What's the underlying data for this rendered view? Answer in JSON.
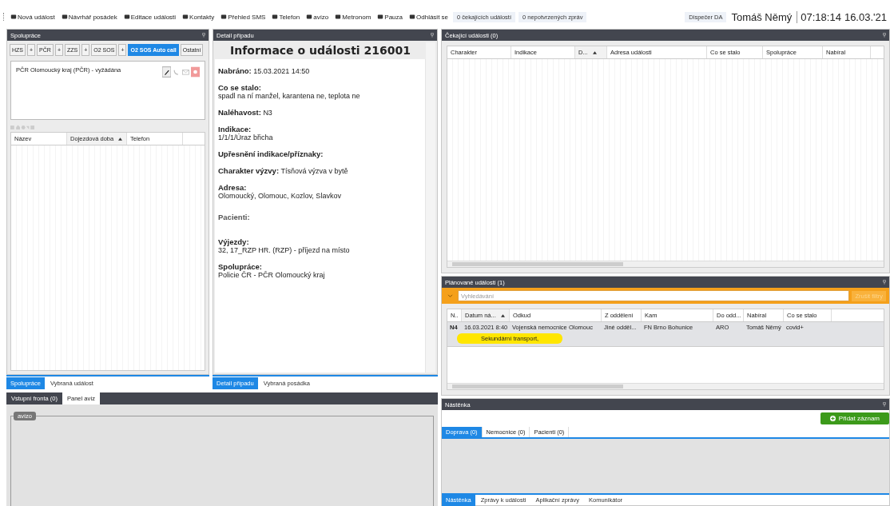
{
  "toolbar": {
    "items": [
      {
        "label": "Nová událost"
      },
      {
        "label": "Návrhář posádek"
      },
      {
        "label": "Editace události"
      },
      {
        "label": "Kontakty"
      },
      {
        "label": "Přehled SMS"
      },
      {
        "label": "Telefon"
      },
      {
        "label": "avízo"
      },
      {
        "label": "Metronom"
      },
      {
        "label": "Pauza"
      },
      {
        "label": "Odhlásit se"
      }
    ],
    "counters": [
      "0 čekajících událostí",
      "0 nepotvrzených zpráv"
    ],
    "role": "Dispečer DA",
    "user": "Tomáš Němý",
    "time": "07:18:14",
    "date": "16.03.'21"
  },
  "cooperation": {
    "title": "Spolupráce",
    "buttons": [
      {
        "label": "HZS",
        "selected": false
      },
      {
        "label": "+",
        "selected": false
      },
      {
        "label": "PČR",
        "selected": false
      },
      {
        "label": "+",
        "selected": false
      },
      {
        "label": "ZZS",
        "selected": false
      },
      {
        "label": "+",
        "selected": false
      },
      {
        "label": "O2 SOS",
        "selected": false
      },
      {
        "label": "+",
        "selected": false
      },
      {
        "label": "O2 SOS Auto call",
        "selected": true
      },
      {
        "label": "Ostatní",
        "selected": false
      }
    ],
    "items": [
      {
        "text": "PČR Olomoucký kraj (PČR) - vyžádána"
      }
    ],
    "columns": [
      {
        "label": "Název",
        "sorted": false
      },
      {
        "label": "Dojezdová doba",
        "sorted": true
      },
      {
        "label": "Telefon",
        "sorted": false
      }
    ],
    "tabs": [
      {
        "label": "Spolupráce",
        "selected": true
      },
      {
        "label": "Vybraná událost",
        "selected": false
      }
    ]
  },
  "detail": {
    "title": "Detail případu",
    "heading": "Informace o události 216001",
    "fields": [
      {
        "kind": "inline",
        "label": "Nabráno:",
        "value": "15.03.2021 14:50"
      },
      {
        "kind": "block",
        "label": "Co se stalo:",
        "value": "spadl na ní manžel, karantena ne, teplota ne"
      },
      {
        "kind": "inline",
        "label": "Naléhavost:",
        "value": "N3"
      },
      {
        "kind": "block",
        "label": "Indikace:",
        "value": "1/1/1/Úraz břicha"
      },
      {
        "kind": "block",
        "label": "Upřesnění indikace/příznaky:"
      },
      {
        "kind": "inline",
        "label": "Charakter výzvy:",
        "value": "Tísňová výzva v bytě"
      },
      {
        "kind": "block",
        "label": "Adresa:",
        "value": "Olomoucký, Olomouc, Kozlov, Slavkov"
      },
      {
        "kind": "empty",
        "label": "Pacienti:"
      },
      {
        "kind": "block",
        "label": "Výjezdy:",
        "value": "32, 17_RZP HR. (RZP) - příjezd na místo"
      },
      {
        "kind": "block",
        "label": "Spolupráce:",
        "value": "Policie ČR - PČR Olomoucký kraj"
      }
    ],
    "tabs": [
      {
        "label": "Detail případu",
        "selected": true
      },
      {
        "label": "Vybraná posádka",
        "selected": false
      }
    ]
  },
  "waiting": {
    "title": "Čekající události (0)",
    "columns": [
      {
        "label": "Charakter",
        "sorted": false
      },
      {
        "label": "Indikace",
        "sorted": false
      },
      {
        "label": "D...",
        "sorted": true
      },
      {
        "label": "Adresa události",
        "sorted": false
      },
      {
        "label": "Co se stalo",
        "sorted": false
      },
      {
        "label": "Spolupráce",
        "sorted": false
      },
      {
        "label": "Nabíral",
        "sorted": false
      }
    ]
  },
  "planned": {
    "title": "Plánované události (1)",
    "search": {
      "placeholder": "Vyhledávání"
    },
    "clear_button": {
      "label": "Zrušit filtry",
      "disabled": true
    },
    "columns": [
      {
        "label": "N..",
        "sorted": false
      },
      {
        "label": "Datum ná...",
        "sorted": true
      },
      {
        "label": "Odkud",
        "sorted": false
      },
      {
        "label": "Z oddělení",
        "sorted": false
      },
      {
        "label": "Kam",
        "sorted": false
      },
      {
        "label": "Do odd...",
        "sorted": false
      },
      {
        "label": "Nabíral",
        "sorted": false
      },
      {
        "label": "Co se stalo",
        "sorted": false
      }
    ],
    "rows": [
      {
        "selected": true,
        "cells": [
          "N4",
          "16.03.2021 8:40",
          "Vojenská nemocnice Olomouc",
          "Jiné odděl...",
          "FN Brno Bohunice",
          "ARO",
          "Tomáš Němý",
          "covid+"
        ],
        "tag": "Sekundární transport,"
      }
    ]
  },
  "board": {
    "title": "Nástěnka",
    "add_button": "Přidat záznam",
    "tabs": [
      {
        "label": "Doprava (0)",
        "selected": true
      },
      {
        "label": "Nemocnice (0)",
        "selected": false
      },
      {
        "label": "Pacienti (0)",
        "selected": false
      }
    ],
    "bottom_tabs": [
      {
        "label": "Nástěnka",
        "selected": true
      },
      {
        "label": "Zprávy k události",
        "selected": false
      },
      {
        "label": "Aplikační zprávy",
        "selected": false
      },
      {
        "label": "Komunikátor",
        "selected": false
      }
    ]
  },
  "notices": {
    "tabs": [
      {
        "label": "Vstupní fronta (0)",
        "selected": false
      },
      {
        "label": "Panel avíz",
        "selected": true
      }
    ],
    "group": "avízo"
  }
}
